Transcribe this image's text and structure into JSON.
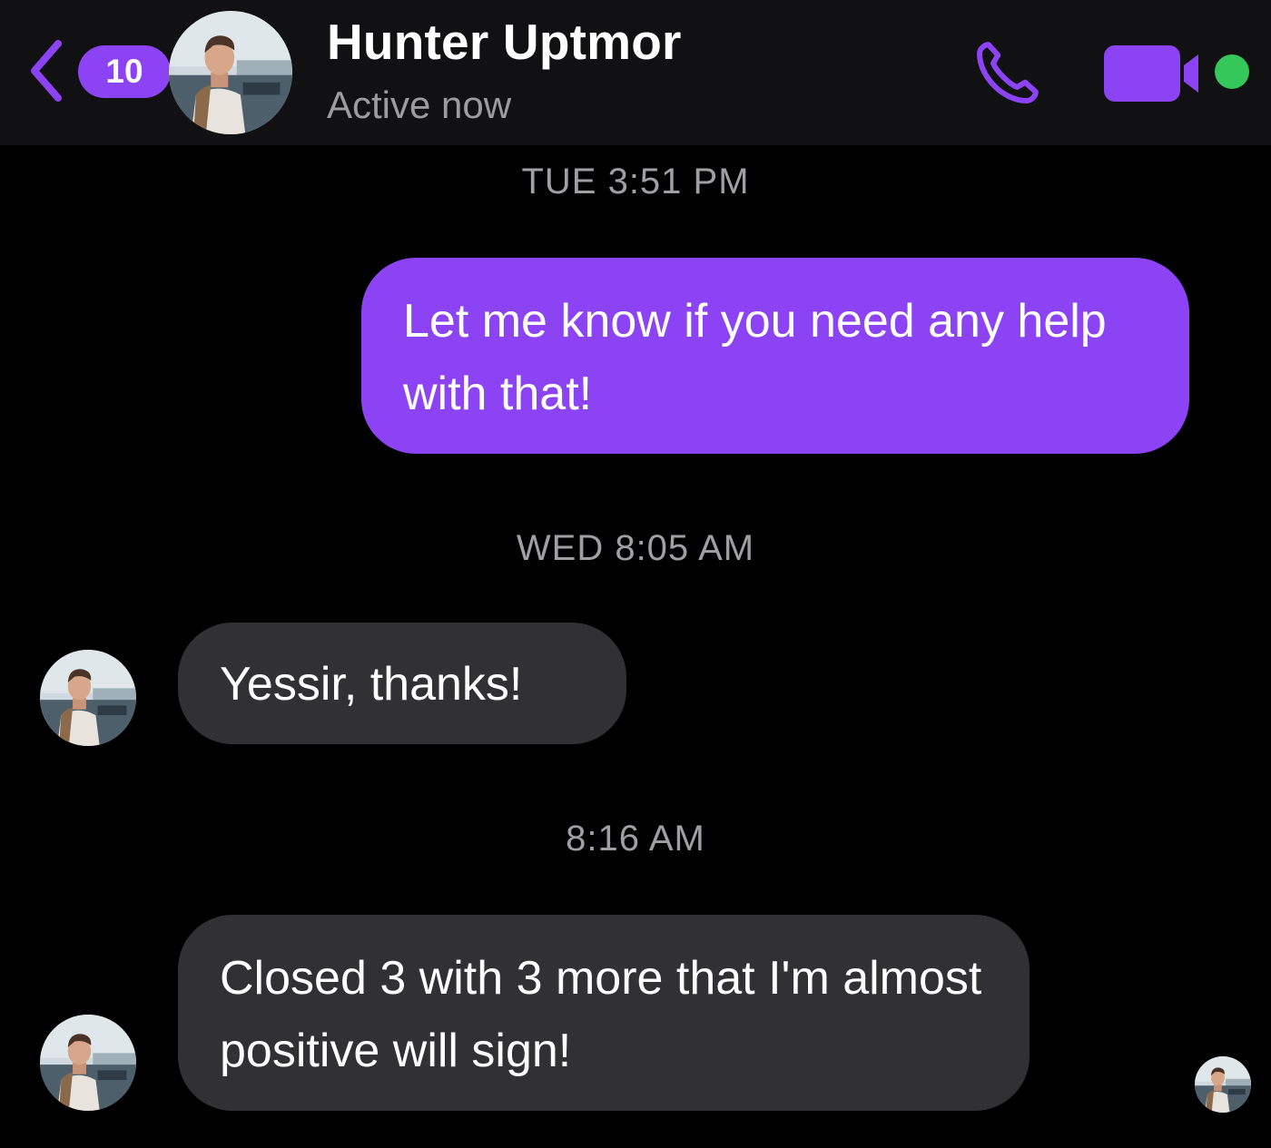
{
  "header": {
    "back_count": "10",
    "contact_name": "Hunter Uptmor",
    "status": "Active now",
    "accent_color": "#8b43f3",
    "online_color": "#35c759",
    "icons": [
      "chevron-left-icon",
      "phone-icon",
      "video-camera-icon"
    ]
  },
  "conversation": {
    "timestamps": [
      "TUE 3:51 PM",
      "WED 8:05 AM",
      "8:16 AM"
    ],
    "messages": [
      {
        "direction": "outgoing",
        "text": "Let me know if you need any help with that!"
      },
      {
        "direction": "incoming",
        "text": "Yessir, thanks!"
      },
      {
        "direction": "incoming",
        "text": "Closed 3 with 3 more that I'm almost positive will sign!"
      }
    ]
  }
}
